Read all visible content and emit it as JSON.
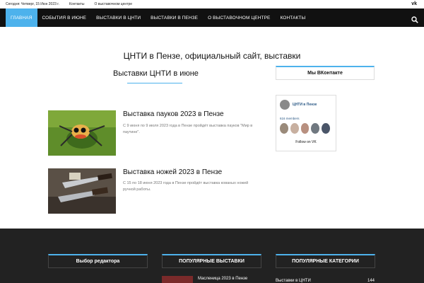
{
  "topbar": {
    "date": "Сегодня: Четверг, 15 Июн 2023 г.",
    "links": [
      "Контакты",
      "О выставочном центре"
    ]
  },
  "nav": {
    "items": [
      "ГЛАВНАЯ",
      "СОБЫТИЯ В ИЮНЕ",
      "ВЫСТАВКИ В ЦНТИ",
      "ВЫСТАВКИ В ПЕНЗЕ",
      "О ВЫСТАВОЧНОМ ЦЕНТРЕ",
      "КОНТАКТЫ"
    ],
    "active_index": 0
  },
  "site_title": "ЦНТИ в Пензе, официальный сайт, выставки",
  "main": {
    "heading": "Выставки ЦНТИ в июне",
    "posts": [
      {
        "title": "Выставка пауков 2023 в Пензе",
        "excerpt": "С 9 июня по 9 июля 2023 года в Пензе пройдёт выставка пауков \"Мир в паутине\"."
      },
      {
        "title": "Выставка ножей 2023 в Пензе",
        "excerpt": "С 15 по 18 июня 2023 года в Пензе пройдёт выставка кованых ножей ручной работы."
      }
    ]
  },
  "sidebar": {
    "box_title": "Мы ВКонтакте",
    "vk": {
      "group_name": "ЦНТИ в Пензе",
      "members": "616 members",
      "follow_label": "Follow on VK"
    }
  },
  "footer": {
    "col1_title": "Выбор редактора",
    "col2_title": "ПОПУЛЯРНЫЕ ВЫСТАВКИ",
    "col3_title": "ПОПУЛЯРНЫЕ КАТЕГОРИИ",
    "popular_item": "Масленица 2023 в Пензе",
    "category_item": "Выставки в ЦНТИ",
    "category_count": "144"
  },
  "colors": {
    "accent": "#4db2ec",
    "nav_bg": "#111111",
    "footer_bg": "#222222"
  }
}
